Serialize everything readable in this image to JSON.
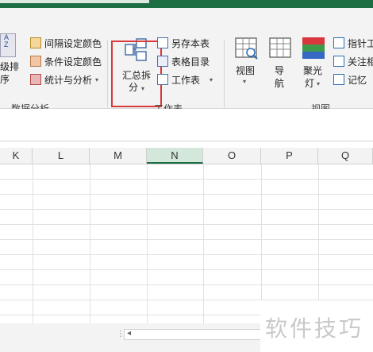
{
  "ribbon": {
    "data_analysis": {
      "partial_label_top": "级排",
      "partial_label_bottom": "序",
      "interval_color": "间隔设定颜色",
      "conditional_color": "条件设定颜色",
      "stats_analysis": "统计与分析",
      "group_label": "数据分析"
    },
    "worksheet": {
      "summarize_split_line1": "汇总拆",
      "summarize_split_line2": "分",
      "save_sheet": "另存本表",
      "sheet_directory": "表格目录",
      "worksheet_menu": "工作表",
      "group_label": "工作表"
    },
    "view": {
      "view_label": "视图",
      "navigation_line1": "导",
      "navigation_line2": "航",
      "focus_line1": "聚光",
      "focus_line2": "灯",
      "pointer_tool": "指针工",
      "focus_related": "关注相",
      "memory": "记忆",
      "group_label": "视图"
    }
  },
  "grid": {
    "columns": [
      "K",
      "L",
      "M",
      "N",
      "O",
      "P",
      "Q"
    ],
    "selected_column": "N"
  },
  "watermark": "软件技巧",
  "colors": {
    "title_green": "#1e6e44",
    "highlight_red": "#d83a3a",
    "selected_column": "#d3e8da"
  }
}
